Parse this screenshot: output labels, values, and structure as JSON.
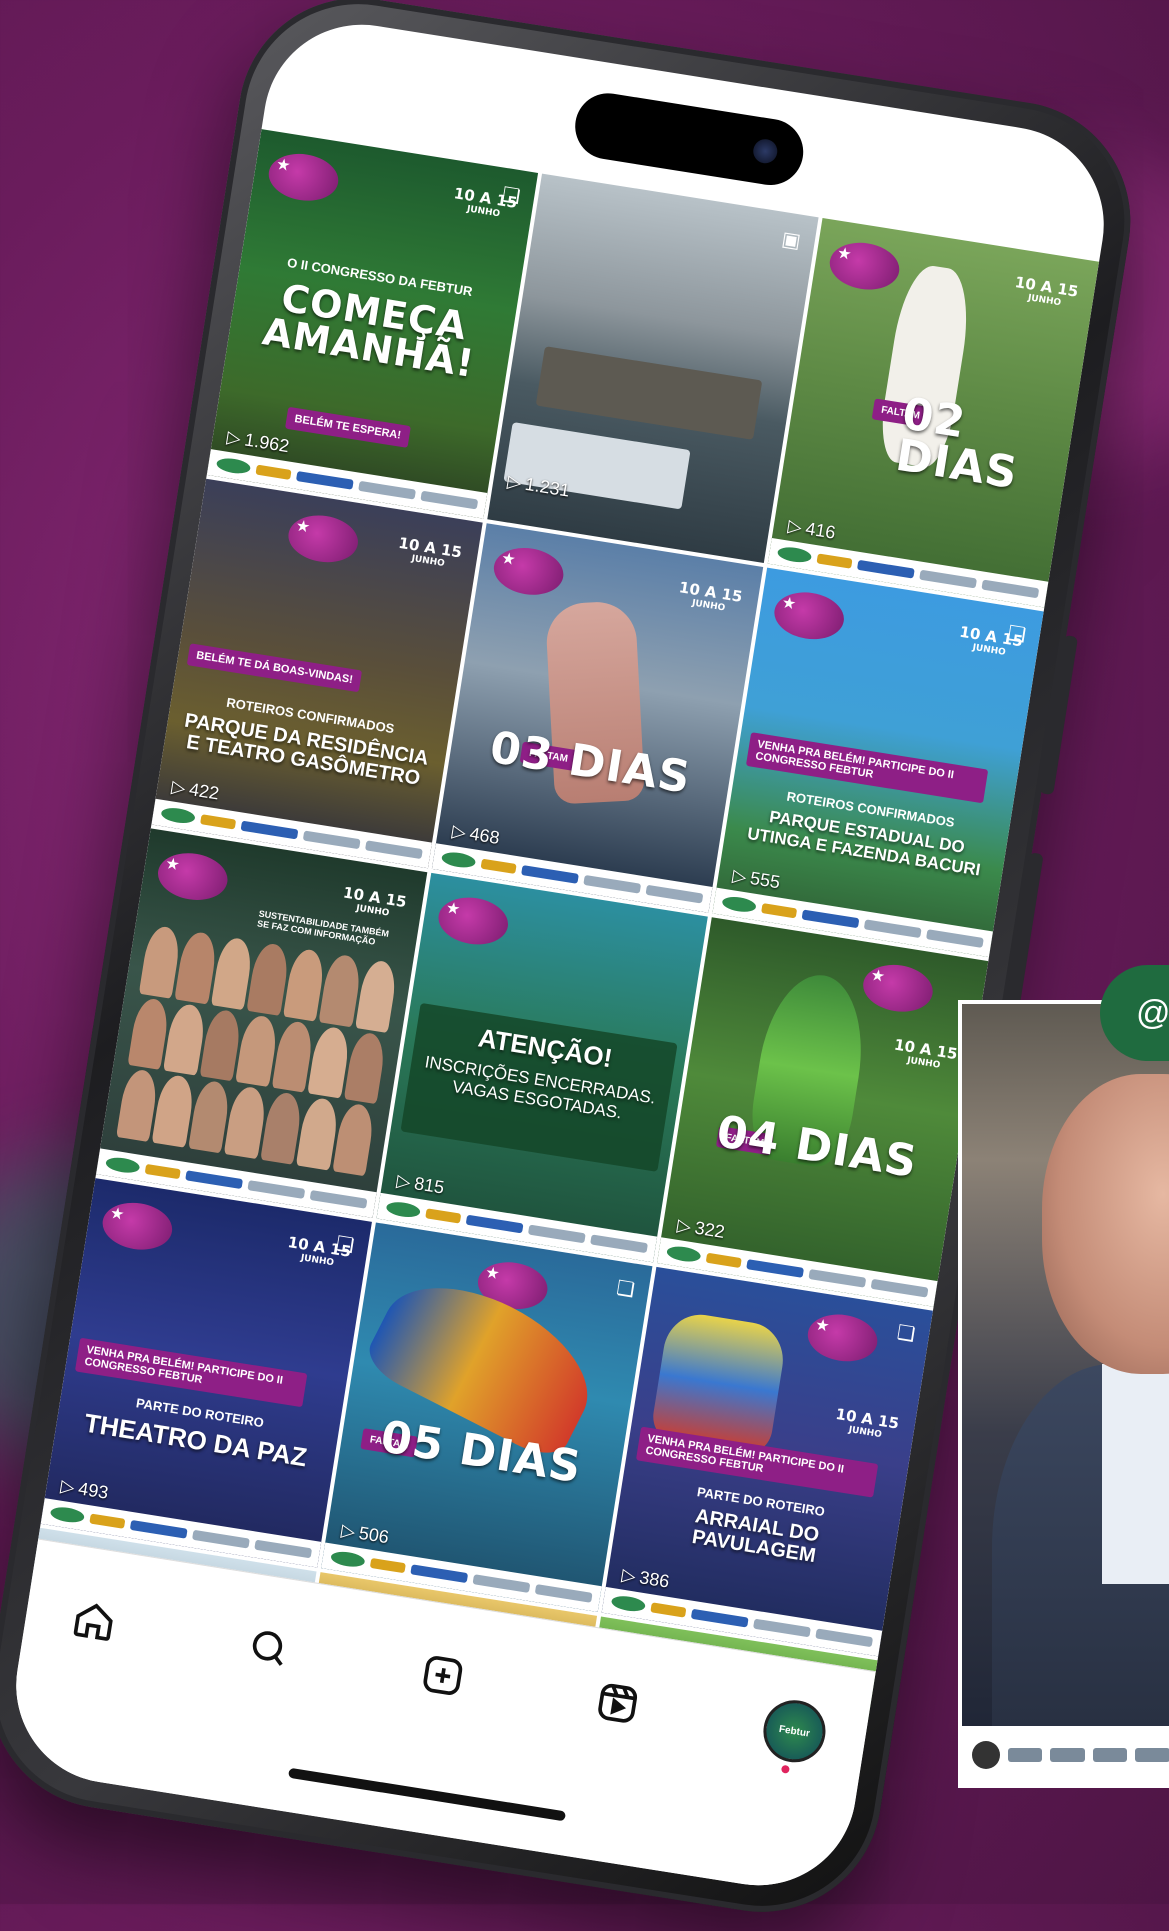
{
  "overlay": {
    "handle": "@f"
  },
  "tiles": [
    {
      "kicker": "O II CONGRESSO DA FEBTUR",
      "headline": "COMEÇA AMANHÃ!",
      "badge": "BELÉM TE ESPERA!",
      "views": "1.962",
      "date": "10 A 15",
      "month": "JUNHO"
    },
    {
      "views": "1.231"
    },
    {
      "small": "FALTAM",
      "headline": "02 DIAS",
      "views": "416",
      "date": "10 A 15",
      "month": "JUNHO"
    },
    {
      "badge": "BELÉM TE DÁ BOAS-VINDAS!",
      "kicker": "ROTEIROS CONFIRMADOS",
      "headline": "PARQUE DA RESIDÊNCIA E TEATRO GASÔMETRO",
      "views": "422",
      "date": "10 A 15",
      "month": "JUNHO"
    },
    {
      "small": "FALTAM",
      "headline": "03 DIAS",
      "views": "468",
      "date": "10 A 15",
      "month": "JUNHO"
    },
    {
      "badge": "VENHA PRA BELÉM! PARTICIPE DO II CONGRESSO FEBTUR",
      "kicker": "ROTEIROS CONFIRMADOS",
      "headline": "PARQUE ESTADUAL DO UTINGA E FAZENDA BACURI",
      "views": "555",
      "date": "10 A 15",
      "month": "JUNHO"
    },
    {
      "kicker": "SUSTENTABILIDADE TAMBÉM SE FAZ COM INFORMAÇÃO",
      "date": "10 A 15",
      "month": "JUNHO"
    },
    {
      "headline": "ATENÇÃO!",
      "sub": "INSCRIÇÕES ENCERRADAS. VAGAS ESGOTADAS.",
      "views": "815"
    },
    {
      "small": "FALTAM",
      "headline": "04 DIAS",
      "views": "322",
      "date": "10 A 15",
      "month": "JUNHO"
    },
    {
      "badge": "VENHA PRA BELÉM! PARTICIPE DO II CONGRESSO FEBTUR",
      "kicker": "PARTE DO ROTEIRO",
      "headline": "THEATRO DA PAZ",
      "views": "493",
      "date": "10 A 15",
      "month": "JUNHO"
    },
    {
      "small": "FALTAM",
      "headline": "05 DIAS",
      "views": "506"
    },
    {
      "badge": "VENHA PRA BELÉM! PARTICIPE DO II CONGRESSO FEBTUR",
      "kicker": "PARTE DO ROTEIRO",
      "headline": "ARRAIAL DO PAVULAGEM",
      "views": "386",
      "date": "10 A 15",
      "month": "JUNHO"
    }
  ],
  "nav": {
    "items": [
      "home-icon",
      "search-icon",
      "create-icon",
      "reels-icon",
      "profile-avatar"
    ],
    "avatar_label": "Febtur"
  }
}
